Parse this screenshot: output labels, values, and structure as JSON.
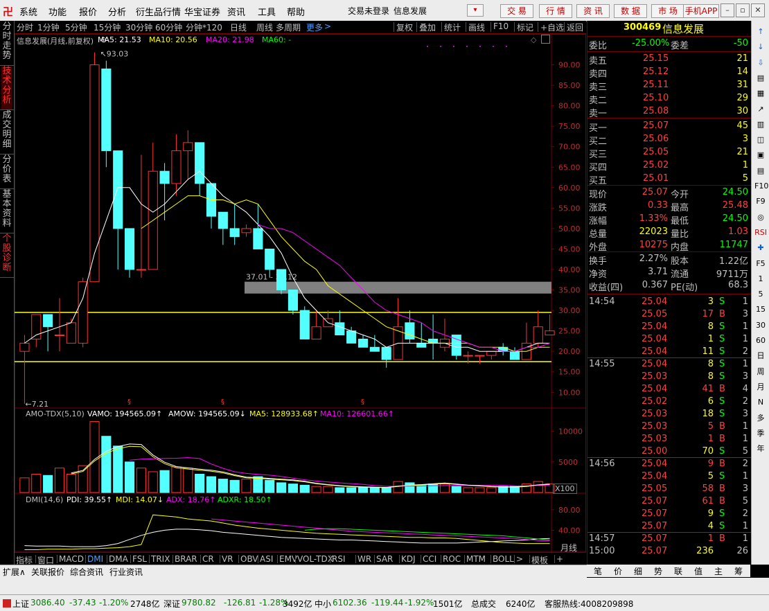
{
  "menubar": {
    "items": [
      "系统",
      "功能",
      "报价",
      "分析",
      "衍生品行情",
      "华宝证券",
      "资讯",
      "工具",
      "帮助"
    ],
    "login_status": "交易未登录",
    "stock_title": "信息发展",
    "buttons": [
      "交 易",
      "行 情",
      "资 讯",
      "数 据",
      "市 场",
      "手机APP"
    ]
  },
  "left_tabs": [
    "分时走势",
    "技术分析",
    "成交明细",
    "分价表",
    "基本资料",
    "个股诊断"
  ],
  "period_bar": {
    "periods": [
      "分时",
      "1分钟",
      "5分钟",
      "15分钟",
      "30分钟",
      "60分钟",
      "分钟*120",
      "日线",
      "周线",
      "多周期"
    ],
    "more": "更多",
    "tools": [
      "复权",
      "叠加",
      "统计",
      "画线",
      "F10",
      "标记",
      "+自选",
      "返回"
    ]
  },
  "main_chart": {
    "title": "信息发展(月线,前复权)",
    "ma": [
      {
        "label": "MA5: 21.53",
        "color": "#ffffff"
      },
      {
        "label": "MA10: 20.56",
        "color": "#ffff00"
      },
      {
        "label": "MA20: 21.98",
        "color": "#ff00ff"
      },
      {
        "label": "MA60: -",
        "color": "#00ff00"
      }
    ],
    "high_mark": "93.03",
    "low_mark": "7.21",
    "box_label": "37.01 - 34.12",
    "y_ticks": [
      "90.00",
      "85.00",
      "80.00",
      "75.00",
      "70.00",
      "65.00",
      "60.00",
      "55.00",
      "50.00",
      "45.00",
      "40.00",
      "35.00",
      "30.00",
      "25.00",
      "20.00",
      "15.00",
      "10.00"
    ]
  },
  "chart_data": {
    "type": "candlestick",
    "candles": [
      [
        20,
        24,
        7.21,
        22
      ],
      [
        23,
        29,
        21,
        29
      ],
      [
        29,
        28,
        20,
        26
      ],
      [
        24,
        33,
        20,
        24
      ],
      [
        22,
        28,
        22,
        27
      ],
      [
        22,
        38,
        21,
        37
      ],
      [
        37,
        93.03,
        37,
        90
      ],
      [
        89,
        91,
        65,
        69
      ],
      [
        69,
        69,
        40,
        50
      ],
      [
        50,
        50,
        38,
        40
      ],
      [
        40,
        68,
        38,
        40
      ],
      [
        40,
        71,
        40,
        64
      ],
      [
        64,
        66,
        52,
        61
      ],
      [
        61,
        73,
        58,
        69
      ],
      [
        69,
        74,
        62,
        71
      ],
      [
        71,
        71,
        58,
        61
      ],
      [
        61,
        56,
        50,
        53
      ],
      [
        54,
        54,
        46,
        50
      ],
      [
        50,
        56,
        46,
        48
      ],
      [
        49,
        51,
        48,
        50
      ],
      [
        50,
        56,
        45,
        45
      ],
      [
        45,
        45,
        38,
        40
      ],
      [
        40,
        40,
        34,
        35
      ],
      [
        35,
        35,
        29,
        30
      ],
      [
        30,
        31,
        23,
        23
      ],
      [
        23,
        30,
        23,
        26
      ],
      [
        26,
        30,
        26,
        28
      ],
      [
        27,
        30,
        24,
        24
      ],
      [
        25,
        26,
        22,
        22
      ],
      [
        23,
        24,
        21,
        21
      ],
      [
        21,
        24,
        20,
        20
      ],
      [
        21,
        21,
        16,
        18
      ],
      [
        18,
        33,
        18,
        26
      ],
      [
        27,
        30,
        22,
        23
      ],
      [
        22,
        27,
        21,
        21
      ],
      [
        23,
        29,
        18,
        22
      ],
      [
        21,
        28,
        20,
        23
      ],
      [
        24,
        24,
        18,
        19
      ],
      [
        19,
        20,
        17,
        19
      ],
      [
        19,
        19,
        17,
        19
      ],
      [
        19,
        20,
        18,
        20
      ],
      [
        21,
        22,
        19,
        20
      ],
      [
        20,
        21,
        18,
        18
      ],
      [
        18,
        27,
        18,
        22
      ],
      [
        22,
        30,
        21,
        26
      ],
      [
        24,
        29,
        24,
        25
      ]
    ],
    "ma5": [
      22,
      24,
      25,
      26,
      27,
      33,
      44,
      52,
      60,
      60,
      56,
      54,
      56,
      59,
      62,
      64,
      61,
      58,
      56,
      54,
      51,
      48,
      44,
      38,
      33,
      30,
      27,
      26,
      25,
      24,
      23,
      21,
      22,
      22,
      22,
      22,
      22,
      21,
      21,
      20,
      20,
      20,
      20,
      21,
      22,
      22
    ],
    "ma10": [
      null,
      null,
      null,
      null,
      null,
      null,
      null,
      null,
      null,
      null,
      50,
      52,
      54,
      56,
      58,
      58,
      57,
      57,
      56,
      57,
      56,
      52,
      48,
      45,
      42,
      40,
      36,
      34,
      32,
      30,
      28,
      26,
      25,
      24,
      23,
      22,
      22,
      22,
      22,
      21,
      21,
      21,
      20,
      20,
      21,
      21
    ],
    "ma20": [
      null,
      null,
      null,
      null,
      null,
      null,
      null,
      null,
      null,
      null,
      null,
      null,
      null,
      null,
      null,
      null,
      null,
      null,
      null,
      null,
      51,
      50,
      50,
      49,
      47,
      45,
      43,
      41,
      38,
      35,
      32,
      30,
      29,
      28,
      27,
      25,
      24,
      23,
      22,
      21,
      21,
      20,
      20,
      21,
      21,
      22
    ],
    "y_range": [
      7,
      95
    ],
    "x_labels": [
      {
        "idx": 0,
        "label": "2015年"
      },
      {
        "idx": 5,
        "label": "10"
      },
      {
        "idx": 7,
        "label": "12"
      },
      {
        "idx": 9,
        "label": "2"
      },
      {
        "idx": 11,
        "label": "4"
      },
      {
        "idx": 13,
        "label": "6"
      },
      {
        "idx": 15,
        "label": "8"
      },
      {
        "idx": 17,
        "label": "10"
      },
      {
        "idx": 19,
        "label": "12"
      },
      {
        "idx": 21,
        "label": "2"
      },
      {
        "idx": 23,
        "label": "4"
      },
      {
        "idx": 25,
        "label": "6"
      },
      {
        "idx": 27,
        "label": "8"
      },
      {
        "idx": 29,
        "label": "10"
      },
      {
        "idx": 31,
        "label": "12"
      },
      {
        "idx": 33,
        "label": "2"
      },
      {
        "idx": 35,
        "label": "4"
      },
      {
        "idx": 37,
        "label": "6"
      },
      {
        "idx": 39,
        "label": "8"
      },
      {
        "idx": 41,
        "label": "10"
      },
      {
        "idx": 43,
        "label": "12"
      },
      {
        "idx": 45,
        "label": "2"
      }
    ],
    "volumes": [
      12,
      15,
      14,
      20,
      15,
      22,
      58,
      46,
      38,
      25,
      20,
      17,
      18,
      21,
      20,
      15,
      13,
      11,
      10,
      11,
      13,
      10,
      8,
      7,
      6,
      5,
      5,
      4,
      4,
      4,
      4,
      4,
      9,
      8,
      6,
      7,
      7,
      5,
      4,
      4,
      4,
      5,
      5,
      7,
      9,
      7
    ],
    "vol_ticks": [
      "10000",
      "5000"
    ],
    "dmi_ticks": [
      "80.00",
      "40.00"
    ],
    "dmi_lines": {
      "pdi": [
        10,
        9,
        9,
        9,
        8,
        8,
        8,
        10,
        14,
        22,
        30,
        36,
        40,
        42,
        42,
        41,
        39,
        36,
        34,
        32,
        30,
        28,
        26,
        25,
        24,
        23,
        22,
        21,
        21,
        20,
        19,
        18,
        17,
        16,
        15,
        15,
        15,
        15,
        16,
        17,
        18,
        19,
        20,
        21,
        23,
        24
      ],
      "mdi": [
        2,
        2,
        3,
        3,
        3,
        4,
        4,
        5,
        6,
        8,
        12,
        70,
        68,
        66,
        62,
        60,
        58,
        54,
        50,
        47,
        44,
        42,
        40,
        38,
        36,
        34,
        33,
        32,
        31,
        30,
        29,
        28,
        27,
        26,
        26,
        25,
        25,
        24,
        22,
        20,
        18,
        16,
        15,
        14,
        14,
        14
      ],
      "adx": [
        null,
        null,
        null,
        null,
        null,
        null,
        null,
        null,
        null,
        null,
        null,
        null,
        null,
        null,
        null,
        null,
        62,
        60,
        58,
        56,
        54,
        52,
        50,
        48,
        46,
        44,
        42,
        40,
        38,
        37,
        36,
        35,
        34,
        33,
        32,
        31,
        30,
        29,
        28,
        27,
        26,
        25,
        24,
        22,
        20,
        19
      ],
      "adxr": [
        null,
        null,
        null,
        null,
        null,
        null,
        null,
        null,
        null,
        null,
        null,
        null,
        null,
        null,
        null,
        null,
        null,
        null,
        null,
        null,
        null,
        null,
        null,
        null,
        40,
        42,
        43,
        43,
        42,
        41,
        40,
        39,
        38,
        37,
        36,
        35,
        34,
        33,
        32,
        31,
        30,
        29,
        27,
        25,
        23,
        21
      ]
    }
  },
  "vol_panel": {
    "labels": [
      {
        "t": "AMO-TDX(5,10)",
        "c": "#c0c0c0"
      },
      {
        "t": "VAMO: 194565.09↑",
        "c": "#ffffff"
      },
      {
        "t": "AMOW: 194565.09↓",
        "c": "#ffffff"
      },
      {
        "t": "MA5: 128933.68↑",
        "c": "#ffff00"
      },
      {
        "t": "MA10: 126601.66↑",
        "c": "#ff00ff"
      }
    ],
    "unit": "X100"
  },
  "dmi_panel": {
    "labels": [
      {
        "t": "DMI(14,6)",
        "c": "#c0c0c0"
      },
      {
        "t": "PDI: 39.55↑",
        "c": "#ffffff"
      },
      {
        "t": "MDI: 14.07↓",
        "c": "#ffff00"
      },
      {
        "t": "ADX: 18.76↑",
        "c": "#ff00ff"
      },
      {
        "t": "ADXR: 18.50↑",
        "c": "#00ff00"
      }
    ],
    "period_label": "月线"
  },
  "indicator_tabs": [
    "指标",
    "窗口",
    "MACD",
    "DMI",
    "DMA",
    "FSL",
    "TRIX",
    "BRAR",
    "CR",
    "VR",
    "OBV",
    "ASI",
    "EMV",
    "VOL-TDX",
    "RSI",
    "WR",
    "SAR",
    "KDJ",
    "CCI",
    "ROC",
    "MTM",
    "BOLL",
    ">",
    "模板",
    "+"
  ],
  "info_tabs": [
    "扩展∧",
    "关联报价",
    "综合资讯",
    "行业资讯"
  ],
  "quote": {
    "code": "300469",
    "name": "信息发展",
    "wei_bi_label": "委比",
    "wei_bi": "-25.00%",
    "wei_cha_label": "委差",
    "wei_cha": "-50",
    "sells": [
      {
        "label": "卖五",
        "price": "25.15",
        "vol": "21"
      },
      {
        "label": "卖四",
        "price": "25.12",
        "vol": "14"
      },
      {
        "label": "卖三",
        "price": "25.11",
        "vol": "31"
      },
      {
        "label": "卖二",
        "price": "25.10",
        "vol": "29"
      },
      {
        "label": "卖一",
        "price": "25.08",
        "vol": "30"
      }
    ],
    "buys": [
      {
        "label": "买一",
        "price": "25.07",
        "vol": "45"
      },
      {
        "label": "买二",
        "price": "25.06",
        "vol": "3"
      },
      {
        "label": "买三",
        "price": "25.05",
        "vol": "21"
      },
      {
        "label": "买四",
        "price": "25.02",
        "vol": "1"
      },
      {
        "label": "买五",
        "price": "25.01",
        "vol": "5"
      }
    ],
    "stats": [
      {
        "l1": "现价",
        "v1": "25.07",
        "c1": "#ff4040",
        "l2": "今开",
        "v2": "24.50",
        "c2": "#00ff00"
      },
      {
        "l1": "涨跌",
        "v1": "0.33",
        "c1": "#ff4040",
        "l2": "最高",
        "v2": "25.48",
        "c2": "#ff4040"
      },
      {
        "l1": "涨幅",
        "v1": "1.33%",
        "c1": "#ff4040",
        "l2": "最低",
        "v2": "24.50",
        "c2": "#00ff00"
      },
      {
        "l1": "总量",
        "v1": "22023",
        "c1": "#ffff00",
        "l2": "量比",
        "v2": "1.03",
        "c2": "#ff4040"
      },
      {
        "l1": "外盘",
        "v1": "10275",
        "c1": "#ff4040",
        "l2": "内盘",
        "v2": "11747",
        "c2": "#00ff00"
      }
    ],
    "stats2": [
      {
        "l1": "换手",
        "v1": "2.27%",
        "l2": "股本",
        "v2": "1.22亿"
      },
      {
        "l1": "净资",
        "v1": "3.71",
        "l2": "流通",
        "v2": "9711万"
      },
      {
        "l1": "收益(四)",
        "v1": "0.367",
        "l2": "PE(动)",
        "v2": "68.3"
      }
    ],
    "ticks": [
      {
        "time": "14:54",
        "price": "25.04",
        "vol": "3",
        "bs": "S",
        "n": "1"
      },
      {
        "time": "",
        "price": "25.05",
        "vol": "17",
        "bs": "B",
        "n": "3"
      },
      {
        "time": "",
        "price": "25.04",
        "vol": "8",
        "bs": "S",
        "n": "1"
      },
      {
        "time": "",
        "price": "25.04",
        "vol": "1",
        "bs": "S",
        "n": "1"
      },
      {
        "time": "",
        "price": "25.04",
        "vol": "11",
        "bs": "S",
        "n": "2"
      },
      {
        "time": "14:55",
        "price": "25.04",
        "vol": "8",
        "bs": "S",
        "n": "1"
      },
      {
        "time": "",
        "price": "25.03",
        "vol": "8",
        "bs": "S",
        "n": "3"
      },
      {
        "time": "",
        "price": "25.04",
        "vol": "41",
        "bs": "B",
        "n": "4"
      },
      {
        "time": "",
        "price": "25.02",
        "vol": "6",
        "bs": "S",
        "n": "2"
      },
      {
        "time": "",
        "price": "25.03",
        "vol": "18",
        "bs": "S",
        "n": "3"
      },
      {
        "time": "",
        "price": "25.03",
        "vol": "5",
        "bs": "B",
        "n": "1"
      },
      {
        "time": "",
        "price": "25.03",
        "vol": "1",
        "bs": "B",
        "n": "1"
      },
      {
        "time": "",
        "price": "25.00",
        "vol": "70",
        "bs": "S",
        "n": "5"
      },
      {
        "time": "14:56",
        "price": "25.04",
        "vol": "9",
        "bs": "B",
        "n": "2"
      },
      {
        "time": "",
        "price": "25.04",
        "vol": "5",
        "bs": "S",
        "n": "1"
      },
      {
        "time": "",
        "price": "25.05",
        "vol": "58",
        "bs": "B",
        "n": "3"
      },
      {
        "time": "",
        "price": "25.07",
        "vol": "61",
        "bs": "B",
        "n": "5"
      },
      {
        "time": "",
        "price": "25.07",
        "vol": "9",
        "bs": "S",
        "n": "2"
      },
      {
        "time": "",
        "price": "25.07",
        "vol": "4",
        "bs": "S",
        "n": "1"
      },
      {
        "time": "14:57",
        "price": "25.07",
        "vol": "1",
        "bs": "B",
        "n": "1"
      },
      {
        "time": "15:00",
        "price": "25.07",
        "vol": "236",
        "bs": "",
        "n": "26"
      }
    ]
  },
  "right_tabs": [
    "笔",
    "价",
    "细",
    "势",
    "联",
    "值",
    "主",
    "筹"
  ],
  "right_icons": [
    "↑",
    "↓",
    "⇩",
    "▤",
    "▦",
    "↗",
    "▥",
    "◫",
    "▣",
    "▤",
    "F10",
    "F9",
    "◎",
    "RSI",
    "✚",
    "F5",
    "1",
    "5",
    "15",
    "30",
    "60",
    "日",
    "周",
    "月",
    "N",
    "多",
    "季",
    "年"
  ],
  "statusbar": {
    "sh_label": "上证",
    "sh_val": "3086.40",
    "sh_chg": "-37.43",
    "sh_pct": "-1.20%",
    "sh_amt": "2748亿",
    "sz_label": "深证",
    "sz_val": "9780.82",
    "sz_chg": "-126.81",
    "sz_pct": "-1.28%",
    "sz_amt": "3492亿",
    "zx_label": "中小",
    "zx_val": "6102.36",
    "zx_chg": "-119.44",
    "zx_pct": "-1.92%",
    "zx_amt": "1501亿",
    "total_label": "总成交",
    "total_val": "6240亿",
    "hotline": "客服热线:4008209898"
  }
}
